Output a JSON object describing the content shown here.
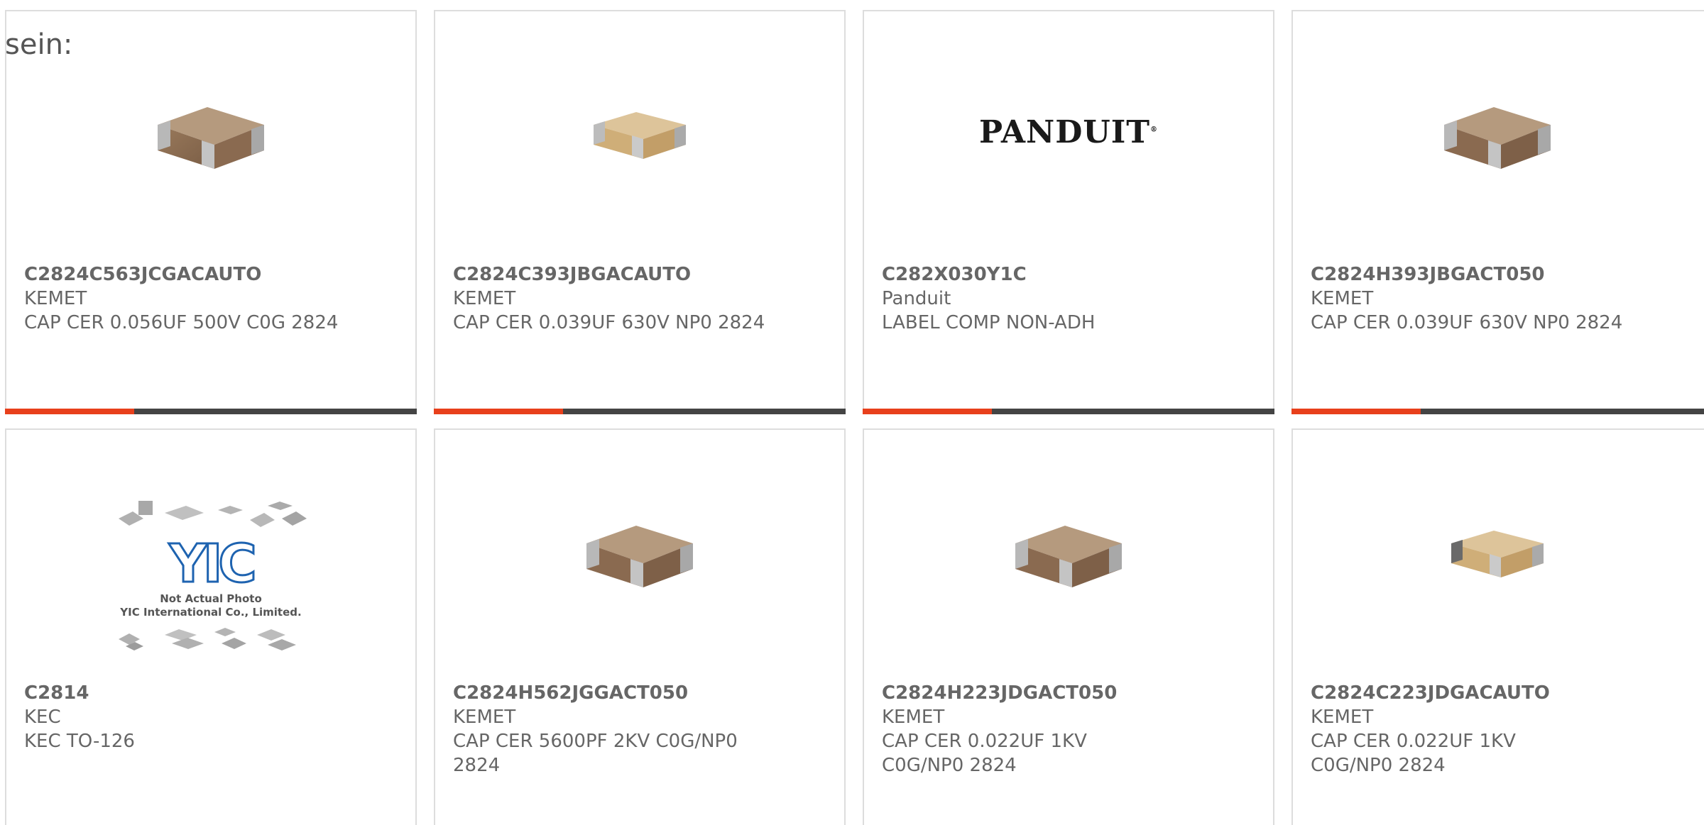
{
  "intro_text": "sein:",
  "colors": {
    "accent": "#e8401c",
    "bar": "#444444",
    "border": "#dddddd"
  },
  "products": [
    {
      "part": "C2824C563JCGACAUTO",
      "mfr": "KEMET",
      "desc": "CAP CER 0.056UF 500V C0G 2824",
      "image": "capacitor-brown-icon"
    },
    {
      "part": "C2824C393JBGACAUTO",
      "mfr": "KEMET",
      "desc": "CAP CER 0.039UF 630V NP0 2824",
      "image": "capacitor-tan-icon"
    },
    {
      "part": "C282X030Y1C",
      "mfr": "Panduit",
      "desc": "LABEL COMP NON-ADH",
      "image": "panduit-logo",
      "logo_text": "PANDUIT",
      "logo_mark": "®"
    },
    {
      "part": "C2824H393JBGACT050",
      "mfr": "KEMET",
      "desc": "CAP CER 0.039UF 630V NP0 2824",
      "image": "capacitor-brown-icon"
    },
    {
      "part": "C2814",
      "mfr": "KEC",
      "desc": "KEC TO-126",
      "image": "yic-placeholder",
      "logo_text": "YIC",
      "caption_1": "Not Actual Photo",
      "caption_2": "YIC International Co., Limited."
    },
    {
      "part": "C2824H562JGGACT050",
      "mfr": "KEMET",
      "desc": "CAP CER 5600PF 2KV C0G/NP0 2824",
      "image": "capacitor-brown-icon"
    },
    {
      "part": "C2824H223JDGACT050",
      "mfr": "KEMET",
      "desc": "CAP CER 0.022UF 1KV C0G/NP0 2824",
      "image": "capacitor-brown-icon"
    },
    {
      "part": "C2824C223JDGACAUTO",
      "mfr": "KEMET",
      "desc": "CAP CER 0.022UF 1KV C0G/NP0 2824",
      "image": "capacitor-tan-icon"
    }
  ]
}
